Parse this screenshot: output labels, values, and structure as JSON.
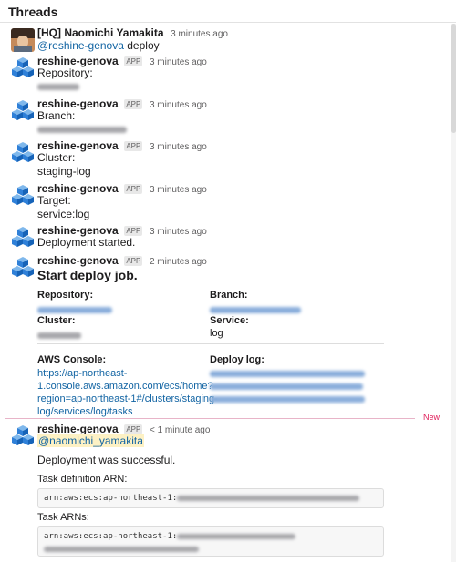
{
  "header": {
    "title": "Threads"
  },
  "messages": {
    "m1": {
      "sender": "[HQ] Naomichi Yamakita",
      "time": "3 minutes ago",
      "mention": "@reshine-genova",
      "text": "deploy"
    },
    "m2": {
      "sender": "reshine-genova",
      "badge": "APP",
      "time": "3 minutes ago",
      "label": "Repository:"
    },
    "m3": {
      "sender": "reshine-genova",
      "badge": "APP",
      "time": "3 minutes ago",
      "label": "Branch:"
    },
    "m4": {
      "sender": "reshine-genova",
      "badge": "APP",
      "time": "3 minutes ago",
      "label": "Cluster:",
      "value": "staging-log"
    },
    "m5": {
      "sender": "reshine-genova",
      "badge": "APP",
      "time": "3 minutes ago",
      "label": "Target:",
      "value": "service:log"
    },
    "m6": {
      "sender": "reshine-genova",
      "badge": "APP",
      "time": "3 minutes ago",
      "text": "Deployment started."
    },
    "m7": {
      "sender": "reshine-genova",
      "badge": "APP",
      "time": "2 minutes ago",
      "title": "Start deploy job.",
      "repository_label": "Repository:",
      "branch_label": "Branch:",
      "cluster_label": "Cluster:",
      "service_label": "Service:",
      "service_value": "log",
      "aws_console_label": "AWS Console:",
      "deploy_log_label": "Deploy log:",
      "aws_link_lines": [
        "https://ap-northeast-",
        "1.console.aws.amazon.com/ecs/home?",
        "region=ap-northeast-1#/clusters/staging-",
        "log/services/log/tasks"
      ]
    },
    "new_label": "New",
    "m8": {
      "sender": "reshine-genova",
      "badge": "APP",
      "time": "< 1 minute ago",
      "mention": "@naomichi_yamakita",
      "text": "Deployment was successful.",
      "task_def_label": "Task definition ARN:",
      "task_def_prefix": "arn:aws:ecs:ap-northeast-1:",
      "task_arns_label": "Task ARNs:",
      "task_arns_prefix": "arn:aws:ecs:ap-northeast-1:"
    }
  },
  "icons": {
    "bot_avatar": "cubes-icon",
    "user_avatar": "user-photo"
  },
  "colors": {
    "link": "#1264a3",
    "new_marker": "#e01e5a",
    "mention_highlight": "#fdf1c4"
  }
}
